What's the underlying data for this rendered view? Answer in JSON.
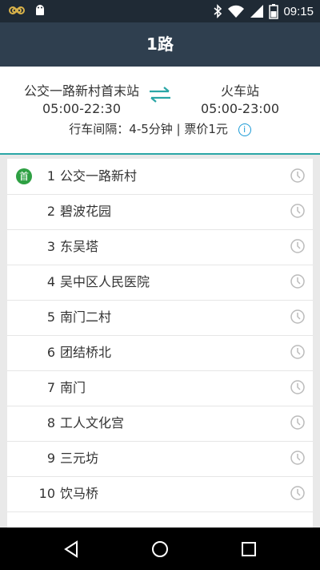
{
  "status_bar": {
    "left_icons": [
      "infinity-icon",
      "android-icon"
    ],
    "right_icons": [
      "bluetooth-icon",
      "wifi-icon",
      "signal-icon",
      "battery-icon"
    ],
    "time": "09:15"
  },
  "app_bar": {
    "title": "1路"
  },
  "route": {
    "from": {
      "name": "公交一路新村首末站",
      "hours": "05:00-22:30"
    },
    "to": {
      "name": "火车站",
      "hours": "05:00-23:00"
    },
    "interval_fare": "行车间隔：4-5分钟 | 票价1元",
    "swap_icon": "swap-arrows-icon",
    "info_icon_glyph": "i"
  },
  "stops": [
    {
      "index": "1",
      "name": "公交一路新村",
      "badge": "首"
    },
    {
      "index": "2",
      "name": "碧波花园"
    },
    {
      "index": "3",
      "name": "东吴塔"
    },
    {
      "index": "4",
      "name": "吴中区人民医院"
    },
    {
      "index": "5",
      "name": "南门二村"
    },
    {
      "index": "6",
      "name": "团结桥北"
    },
    {
      "index": "7",
      "name": "南门"
    },
    {
      "index": "8",
      "name": "工人文化宫"
    },
    {
      "index": "9",
      "name": "三元坊"
    },
    {
      "index": "10",
      "name": "饮马桥"
    }
  ],
  "nav_bar": {
    "buttons": [
      "back-icon",
      "home-icon",
      "recents-icon"
    ]
  },
  "colors": {
    "appbar": "#2f3f4f",
    "accent": "#2aa6a6",
    "first_badge": "#2ea043"
  }
}
